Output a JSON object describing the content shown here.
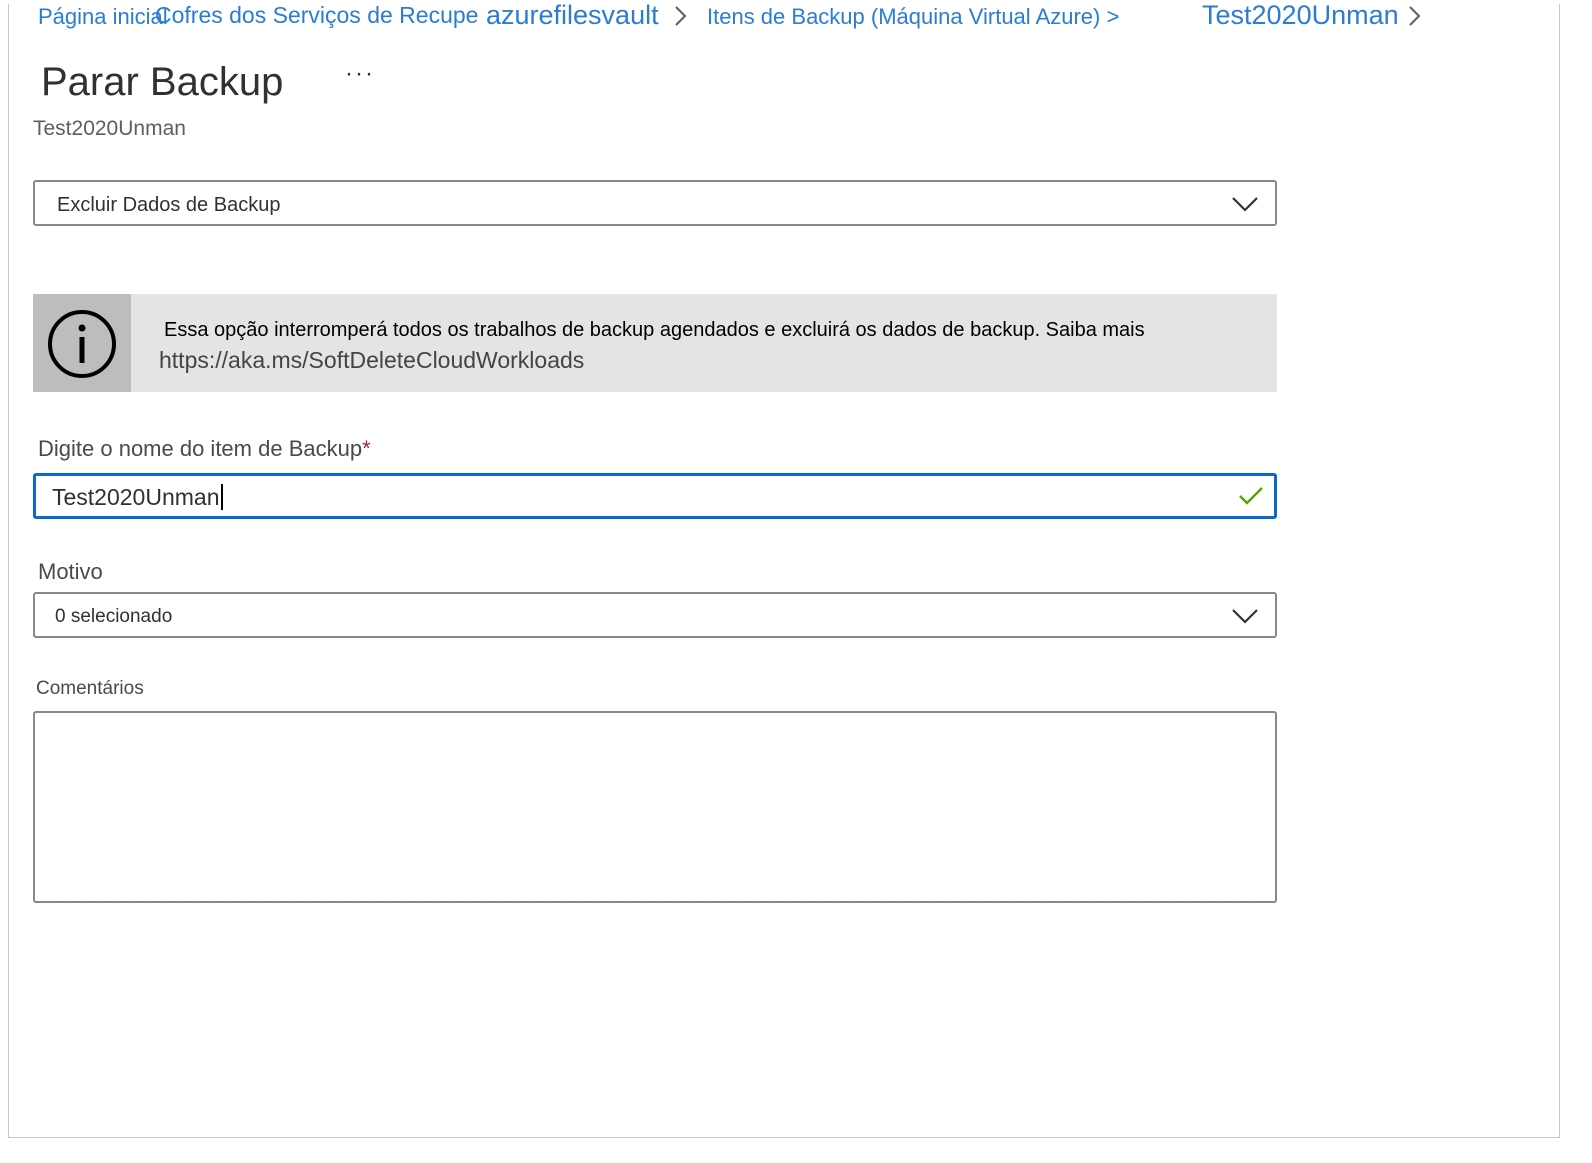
{
  "breadcrumb": {
    "home": "Página inicial",
    "vaults": "Cofres dos Serviços de Recupe",
    "vault": "azurefilesvault",
    "items": "Itens de Backup (Máquina Virtual Azure) >",
    "item": "Test2020Unman"
  },
  "header": {
    "title": "Parar Backup",
    "more": "···",
    "subtitle": "Test2020Unman"
  },
  "stop_option": {
    "selected": "Excluir Dados de Backup"
  },
  "info": {
    "message": "Essa opção interromperá todos os trabalhos de backup agendados e excluirá os dados de backup. Saiba mais",
    "link": "https://aka.ms/SoftDeleteCloudWorkloads"
  },
  "item_name": {
    "label": "Digite o nome do item de Backup",
    "required_mark": "*",
    "value": "Test2020Unman"
  },
  "reason": {
    "label": "Motivo",
    "selected": "0 selecionado"
  },
  "comments": {
    "label": "Comentários",
    "value": ""
  },
  "colors": {
    "link": "#2b7cd3",
    "focus_border": "#0b6ac9",
    "valid_check": "#57a300",
    "required": "#a4262c",
    "info_bg": "#e4e4e4"
  },
  "icons": [
    "chevron-right-icon",
    "chevron-down-icon",
    "info-icon",
    "checkmark-icon"
  ]
}
